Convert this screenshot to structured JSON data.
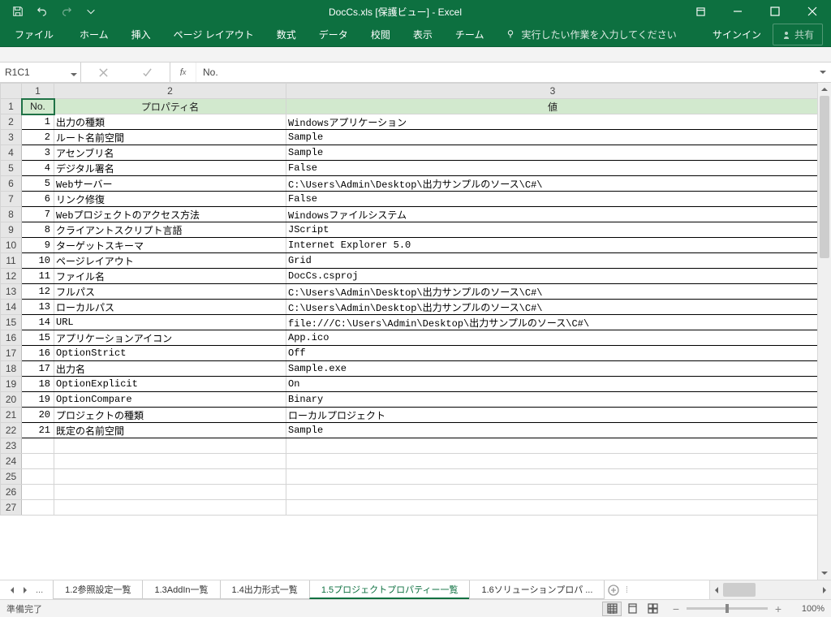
{
  "title": "DocCs.xls  [保護ビュー] - Excel",
  "qat": {
    "save": "save",
    "undo": "undo",
    "redo": "redo"
  },
  "ribbon": {
    "file": "ファイル",
    "tabs": [
      "ホーム",
      "挿入",
      "ページ レイアウト",
      "数式",
      "データ",
      "校閲",
      "表示",
      "チーム"
    ],
    "tell": "実行したい作業を入力してください",
    "signin": "サインイン",
    "share": "共有"
  },
  "namebox": "R1C1",
  "formula": "No.",
  "headers": {
    "col1": "1",
    "col2": "2",
    "col3": "3"
  },
  "grid_headers": {
    "no": "No.",
    "prop": "プロパティ名",
    "val": "値"
  },
  "rows": [
    {
      "n": "1",
      "p": "出力の種類",
      "v": "Windowsアプリケーション"
    },
    {
      "n": "2",
      "p": "ルート名前空間",
      "v": "Sample"
    },
    {
      "n": "3",
      "p": "アセンブリ名",
      "v": "Sample"
    },
    {
      "n": "4",
      "p": "デジタル署名",
      "v": "False"
    },
    {
      "n": "5",
      "p": "Webサーバー",
      "v": "C:\\Users\\Admin\\Desktop\\出力サンプルのソース\\C#\\"
    },
    {
      "n": "6",
      "p": "リンク修復",
      "v": "False"
    },
    {
      "n": "7",
      "p": "Webプロジェクトのアクセス方法",
      "v": "Windowsファイルシステム"
    },
    {
      "n": "8",
      "p": "クライアントスクリプト言語",
      "v": "JScript"
    },
    {
      "n": "9",
      "p": "ターゲットスキーマ",
      "v": "Internet Explorer 5.0"
    },
    {
      "n": "10",
      "p": "ページレイアウト",
      "v": "Grid"
    },
    {
      "n": "11",
      "p": "ファイル名",
      "v": "DocCs.csproj"
    },
    {
      "n": "12",
      "p": "フルパス",
      "v": "C:\\Users\\Admin\\Desktop\\出力サンプルのソース\\C#\\"
    },
    {
      "n": "13",
      "p": "ローカルパス",
      "v": "C:\\Users\\Admin\\Desktop\\出力サンプルのソース\\C#\\"
    },
    {
      "n": "14",
      "p": "URL",
      "v": "file:///C:\\Users\\Admin\\Desktop\\出力サンプルのソース\\C#\\"
    },
    {
      "n": "15",
      "p": "アプリケーションアイコン",
      "v": "App.ico"
    },
    {
      "n": "16",
      "p": "OptionStrict",
      "v": "Off"
    },
    {
      "n": "17",
      "p": "出力名",
      "v": "Sample.exe"
    },
    {
      "n": "18",
      "p": "OptionExplicit",
      "v": "On"
    },
    {
      "n": "19",
      "p": "OptionCompare",
      "v": "Binary"
    },
    {
      "n": "20",
      "p": "プロジェクトの種類",
      "v": "ローカルプロジェクト"
    },
    {
      "n": "21",
      "p": "既定の名前空間",
      "v": "Sample"
    }
  ],
  "empty_rows": [
    23,
    24,
    25,
    26,
    27
  ],
  "sheet_tabs": {
    "ellipsis": "...",
    "tabs": [
      {
        "label": "1.2参照設定一覧",
        "active": false
      },
      {
        "label": "1.3AddIn一覧",
        "active": false
      },
      {
        "label": "1.4出力形式一覧",
        "active": false
      },
      {
        "label": "1.5プロジェクトプロパティー一覧",
        "active": true
      },
      {
        "label": "1.6ソリューションプロパ ...",
        "active": false
      }
    ]
  },
  "status": {
    "ready": "準備完了",
    "zoom": "100%"
  }
}
